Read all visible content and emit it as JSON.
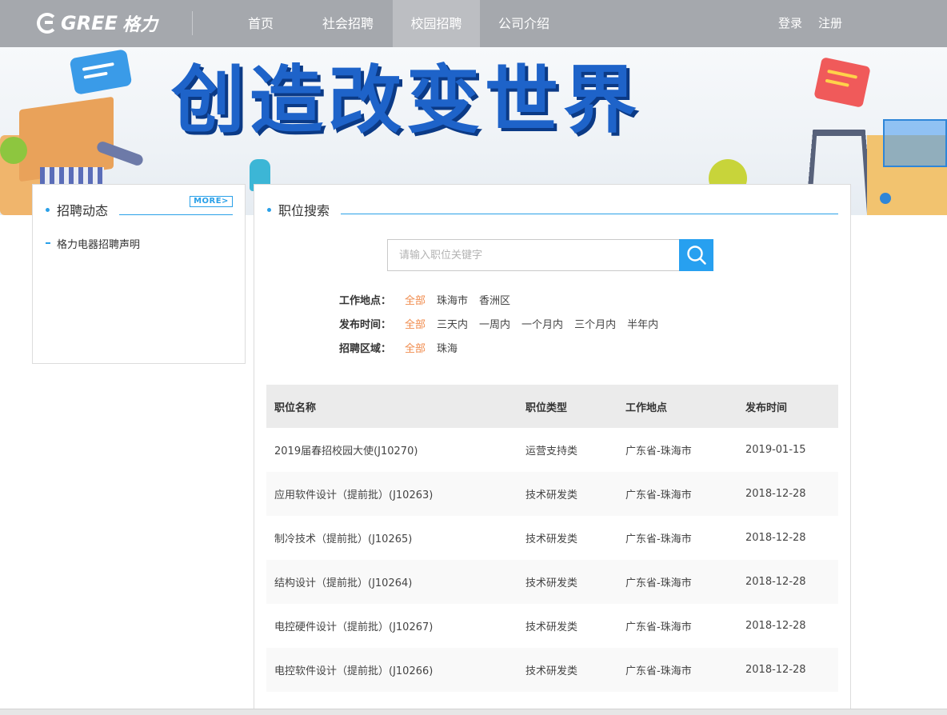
{
  "nav": {
    "logo_text": "GREE",
    "logo_cn": "格力",
    "items": [
      {
        "label": "首页",
        "active": false
      },
      {
        "label": "社会招聘",
        "active": false
      },
      {
        "label": "校园招聘",
        "active": true
      },
      {
        "label": "公司介绍",
        "active": false
      }
    ],
    "login": "登录",
    "register": "注册"
  },
  "banner": {
    "slogan": "创造改变世界"
  },
  "news_panel": {
    "title": "招聘动态",
    "more_label": "MORE>",
    "items": [
      "格力电器招聘声明"
    ]
  },
  "search_panel": {
    "title": "职位搜索",
    "search_placeholder": "请输入职位关键字",
    "filters": {
      "location": {
        "label": "工作地点：",
        "options": [
          "全部",
          "珠海市",
          "香洲区"
        ],
        "selected": "全部"
      },
      "publish_time": {
        "label": "发布时间：",
        "options": [
          "全部",
          "三天内",
          "一周内",
          "一个月内",
          "三个月内",
          "半年内"
        ],
        "selected": "全部"
      },
      "region": {
        "label": "招聘区域：",
        "options": [
          "全部",
          "珠海"
        ],
        "selected": "全部"
      }
    }
  },
  "jobs_table": {
    "headers": [
      "职位名称",
      "职位类型",
      "工作地点",
      "发布时间"
    ],
    "rows": [
      {
        "name": "2019届春招校园大使(J10270)",
        "type": "运营支持类",
        "location": "广东省-珠海市",
        "date": "2019-01-15"
      },
      {
        "name": "应用软件设计（提前批）(J10263)",
        "type": "技术研发类",
        "location": "广东省-珠海市",
        "date": "2018-12-28"
      },
      {
        "name": "制冷技术（提前批）(J10265)",
        "type": "技术研发类",
        "location": "广东省-珠海市",
        "date": "2018-12-28"
      },
      {
        "name": "结构设计（提前批）(J10264)",
        "type": "技术研发类",
        "location": "广东省-珠海市",
        "date": "2018-12-28"
      },
      {
        "name": "电控硬件设计（提前批）(J10267)",
        "type": "技术研发类",
        "location": "广东省-珠海市",
        "date": "2018-12-28"
      },
      {
        "name": "电控软件设计（提前批）(J10266)",
        "type": "技术研发类",
        "location": "广东省-珠海市",
        "date": "2018-12-28"
      }
    ]
  },
  "colors": {
    "nav_bg": "#a5a8ad",
    "accent_blue": "#27a0f0",
    "active_filter": "#f08a4b"
  }
}
